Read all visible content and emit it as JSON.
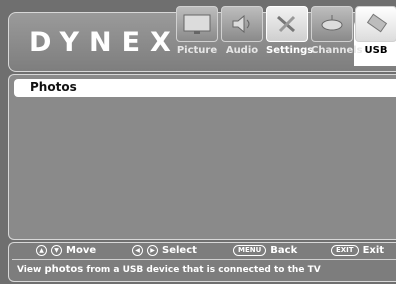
{
  "header": {
    "brand": "DYNEX",
    "menu": [
      {
        "label": "Picture",
        "icon": "monitor-icon"
      },
      {
        "label": "Audio",
        "icon": "speaker-icon"
      },
      {
        "label": "Settings",
        "icon": "tools-icon"
      },
      {
        "label": "Channels",
        "icon": "satellite-icon"
      },
      {
        "label": "USB",
        "icon": "usb-drive-icon"
      }
    ]
  },
  "list": {
    "selected_item": "Photos"
  },
  "footer": {
    "move_label": "Move",
    "select_label": "Select",
    "menu_key": "MENU",
    "back_label": "Back",
    "exit_key": "EXIT",
    "exit_label": "Exit",
    "description_prefix": "View",
    "description_emphasis": "photos",
    "description_suffix": "from a USB device that is connected to the TV"
  }
}
